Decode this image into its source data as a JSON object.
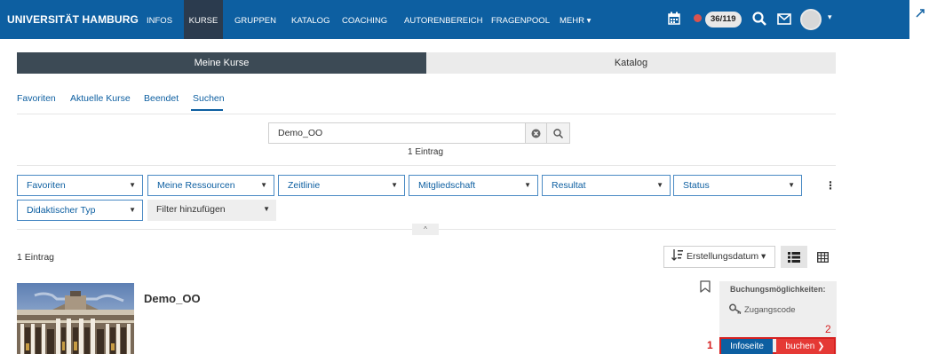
{
  "topbar": {
    "brand": "UNIVERSITÄT HAMBURG",
    "nav": [
      "INFOS",
      "KURSE",
      "GRUPPEN",
      "KATALOG",
      "COACHING",
      "AUTORENBEREICH",
      "FRAGENPOOL",
      "MEHR ▾"
    ],
    "active_nav": "KURSE",
    "counter": "36/119",
    "icons": [
      "calendar-icon",
      "status-dot",
      "search-icon",
      "mail-icon",
      "avatar",
      "expand-icon"
    ],
    "accent_color": "#0d5fa1"
  },
  "main_tabs": {
    "courses": "Meine Kurse",
    "catalog": "Katalog"
  },
  "sub_tabs": [
    "Favoriten",
    "Aktuelle Kurse",
    "Beendet",
    "Suchen"
  ],
  "search": {
    "value": "Demo_OO",
    "placeholder": "",
    "count_label": "1 Eintrag"
  },
  "filters": {
    "favorites": "Favoriten",
    "resources": "Meine Ressourcen",
    "timeline": "Zeitlinie",
    "membership": "Mitgliedschaft",
    "result": "Resultat",
    "status": "Status",
    "didactic": "Didaktischer Typ",
    "add_filter": "Filter hinzufügen",
    "more_menu": "⋮",
    "collapse": "^"
  },
  "results": {
    "count": "1 Eintrag",
    "sort_label": "Erstellungsdatum ▾"
  },
  "course": {
    "title": "Demo_OO",
    "booking_title": "Buchungsmöglichkeiten:",
    "access_code": "Zugangscode",
    "info_button": "Infoseite",
    "book_button": "buchen ❯",
    "marker_1": "1",
    "marker_2": "2",
    "highlight_color": "#d62020"
  }
}
